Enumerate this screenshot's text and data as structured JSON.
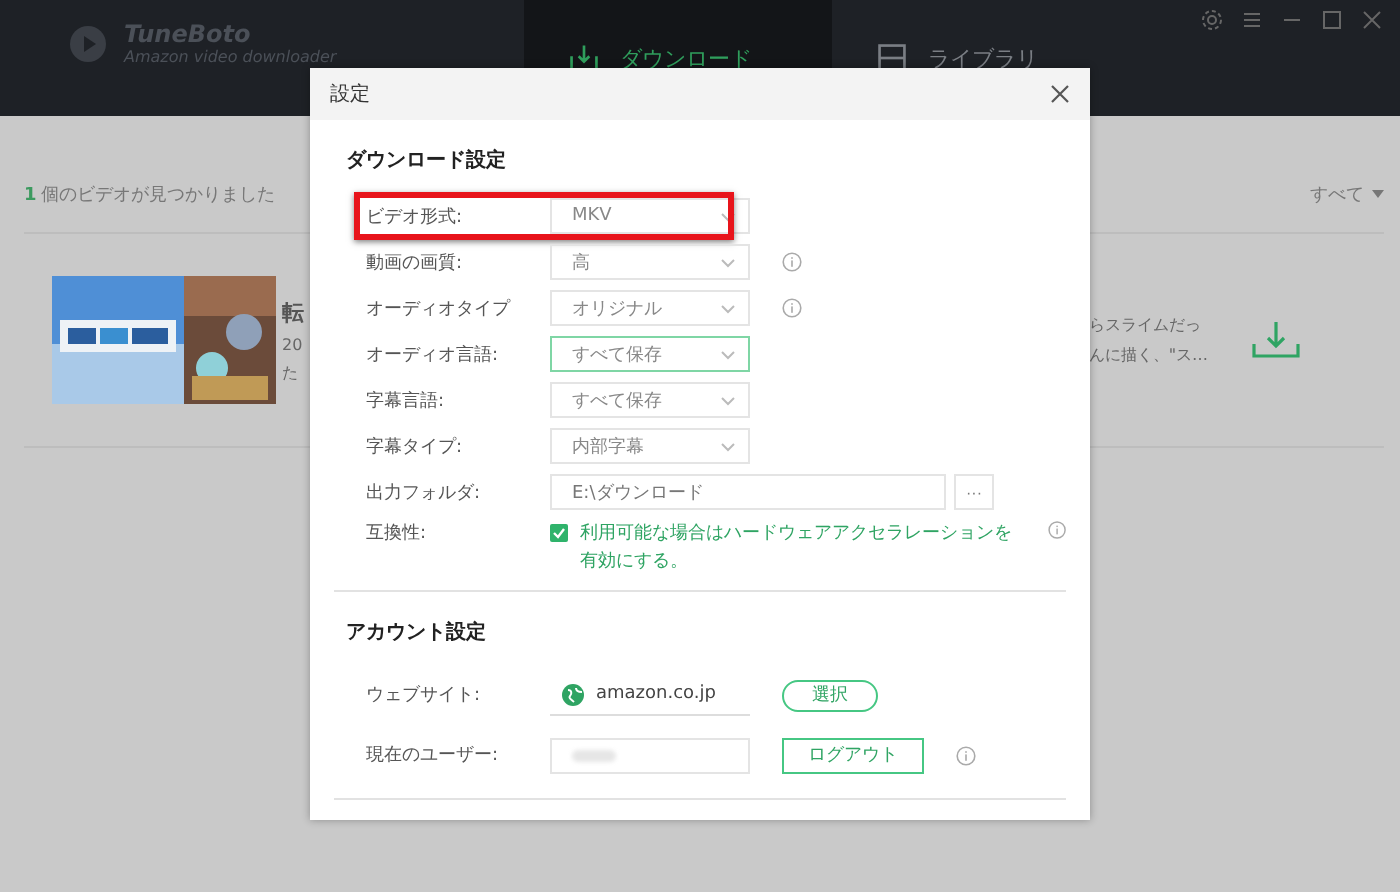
{
  "app": {
    "name": "TuneBoto",
    "subtitle": "Amazon video downloader"
  },
  "tabs": [
    {
      "label": "ダウンロード",
      "selected": true
    },
    {
      "label": "ライブラリ",
      "selected": false
    }
  ],
  "results": {
    "count": "1",
    "text": "個のビデオが見つかりました",
    "filter": "すべて"
  },
  "video": {
    "title": "転",
    "date": "20",
    "description_left": "た",
    "description_right": [
      "らスライムだっ",
      "んに描く、\"ス…"
    ]
  },
  "dialog": {
    "title": "設定",
    "sections": [
      {
        "heading": "ダウンロード設定",
        "rows": [
          {
            "kind": "select",
            "label": "ビデオ形式:",
            "value": "MKV",
            "info": false,
            "focused": false,
            "highlighted": true
          },
          {
            "kind": "select",
            "label": "動画の画質:",
            "value": "高",
            "info": true,
            "focused": false,
            "highlighted": false
          },
          {
            "kind": "select",
            "label": "オーディオタイプ",
            "value": "オリジナル",
            "info": true,
            "focused": false,
            "highlighted": false
          },
          {
            "kind": "select",
            "label": "オーディオ言語:",
            "value": "すべて保存",
            "info": false,
            "focused": true,
            "highlighted": false
          },
          {
            "kind": "select",
            "label": "字幕言語:",
            "value": "すべて保存",
            "info": false,
            "focused": false,
            "highlighted": false
          },
          {
            "kind": "select",
            "label": "字幕タイプ:",
            "value": "内部字幕",
            "info": false,
            "focused": false,
            "highlighted": false
          },
          {
            "kind": "folder",
            "label": "出力フォルダ:",
            "value": "E:\\ダウンロード",
            "button": "···"
          },
          {
            "kind": "checkbox",
            "label": "互換性:",
            "text": "利用可能な場合はハードウェアアクセラレーションを有効にする。",
            "checked": true,
            "info": true
          }
        ]
      },
      {
        "heading": "アカウント設定",
        "rows": [
          {
            "kind": "site",
            "label": "ウェブサイト:",
            "value": "amazon.co.jp",
            "button": "選択"
          },
          {
            "kind": "user",
            "label": "現在のユーザー:",
            "button": "ログアウト",
            "info": true
          }
        ]
      }
    ]
  }
}
